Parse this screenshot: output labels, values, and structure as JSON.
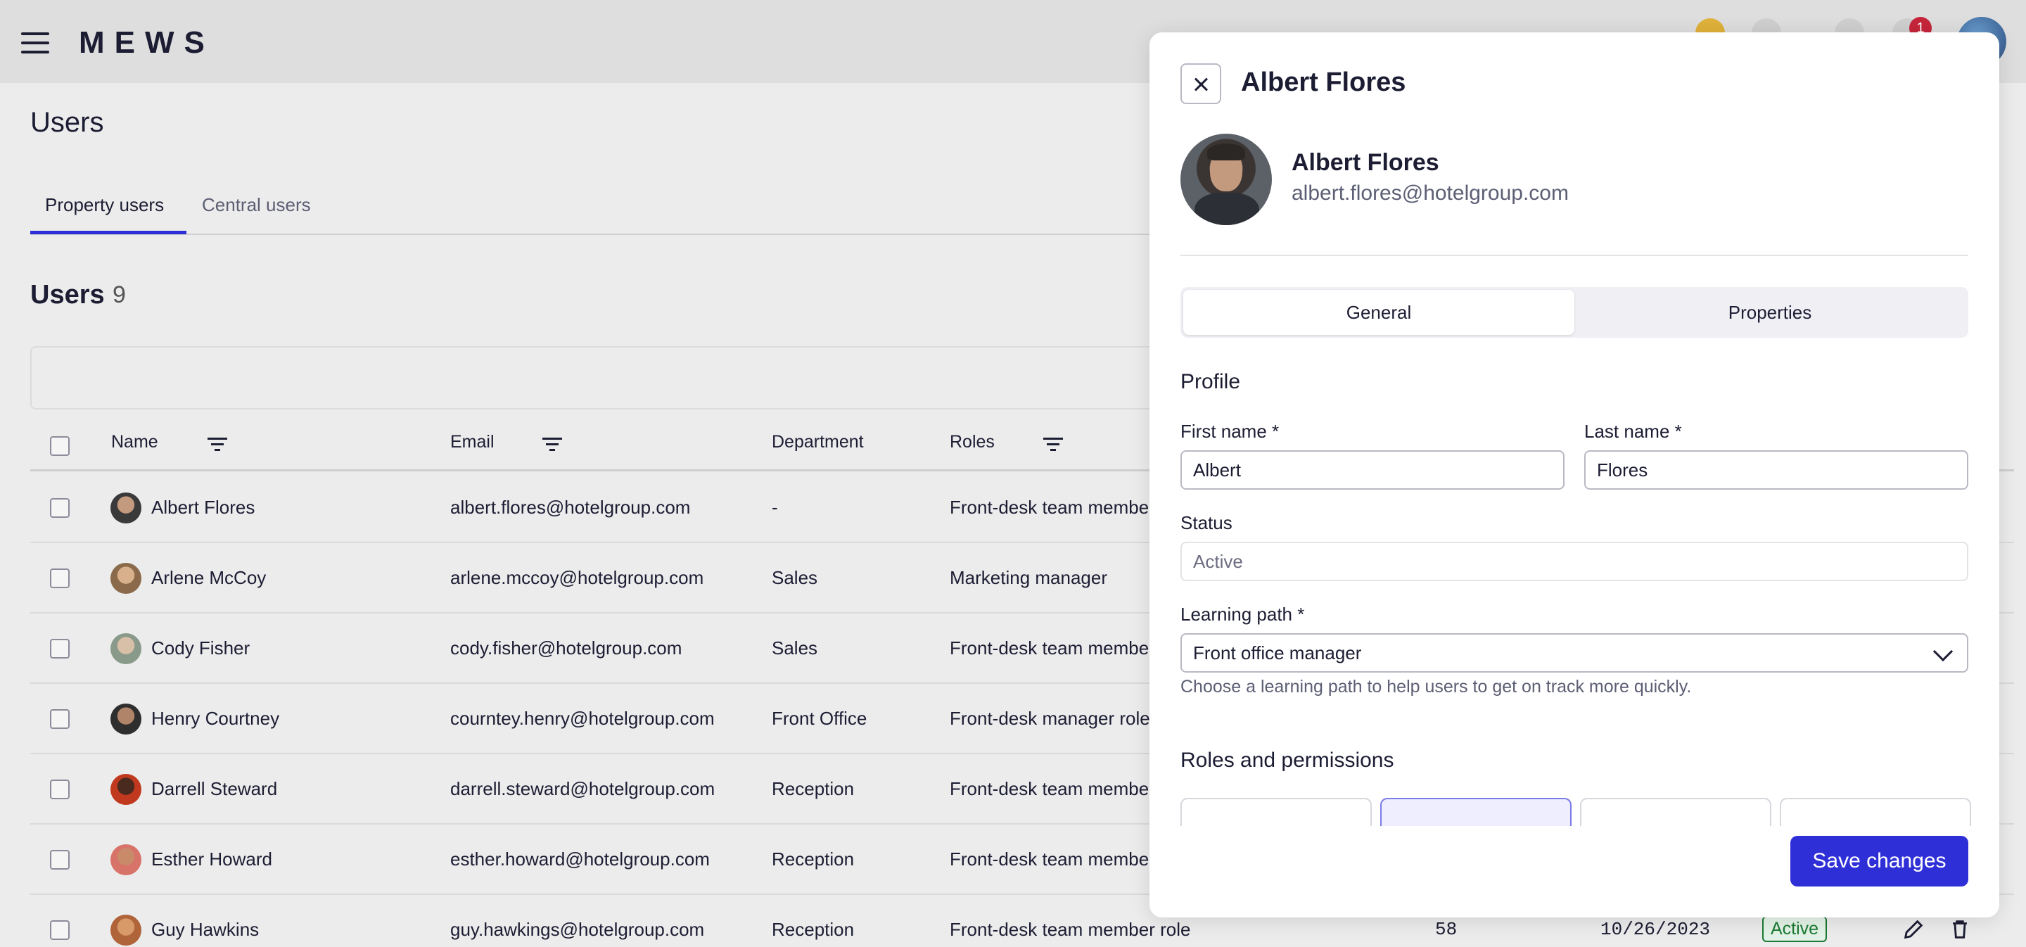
{
  "app": {
    "brand": "MEWS",
    "notifications_count": "1"
  },
  "page": {
    "title": "Users",
    "tabs": [
      {
        "label": "Property users"
      },
      {
        "label": "Central users"
      }
    ],
    "users_heading": "Users",
    "users_count": "9"
  },
  "table": {
    "columns": {
      "name": "Name",
      "email": "Email",
      "department": "Department",
      "roles": "Roles"
    },
    "rows": [
      {
        "name": "Albert Flores",
        "email": "albert.flores@hotelgroup.com",
        "department": "-",
        "role": "Front-desk team member role"
      },
      {
        "name": "Arlene McCoy",
        "email": "arlene.mccoy@hotelgroup.com",
        "department": "Sales",
        "role": "Marketing manager"
      },
      {
        "name": "Cody Fisher",
        "email": "cody.fisher@hotelgroup.com",
        "department": "Sales",
        "role": "Front-desk team member role"
      },
      {
        "name": "Henry Courtney",
        "email": "courntey.henry@hotelgroup.com",
        "department": "Front Office",
        "role": "Front-desk manager role"
      },
      {
        "name": "Darrell Steward",
        "email": "darrell.steward@hotelgroup.com",
        "department": "Reception",
        "role": "Front-desk team member role"
      },
      {
        "name": "Esther Howard",
        "email": "esther.howard@hotelgroup.com",
        "department": "Reception",
        "role": "Front-desk team member role"
      },
      {
        "name": "Guy Hawkins",
        "email": "guy.hawkings@hotelgroup.com",
        "department": "Reception",
        "role": "Front-desk team member role",
        "count": "58",
        "date": "10/26/2023",
        "status": "Active"
      }
    ]
  },
  "panel": {
    "title": "Albert Flores",
    "profile_name": "Albert Flores",
    "profile_email": "albert.flores@hotelgroup.com",
    "tabs": {
      "general": "General",
      "properties": "Properties"
    },
    "profile_section": "Profile",
    "first_name_label": "First name *",
    "first_name_value": "Albert",
    "last_name_label": "Last name *",
    "last_name_value": "Flores",
    "status_label": "Status",
    "status_value": "Active",
    "learning_path_label": "Learning path *",
    "learning_path_value": "Front office manager",
    "learning_path_hint": "Choose a learning path to help users to get on track more quickly.",
    "roles_section": "Roles and permissions",
    "save_label": "Save changes"
  },
  "colors": {
    "accent": "#2f2fd8",
    "status_active": "#1a7a34",
    "badge_red": "#c6253a"
  }
}
